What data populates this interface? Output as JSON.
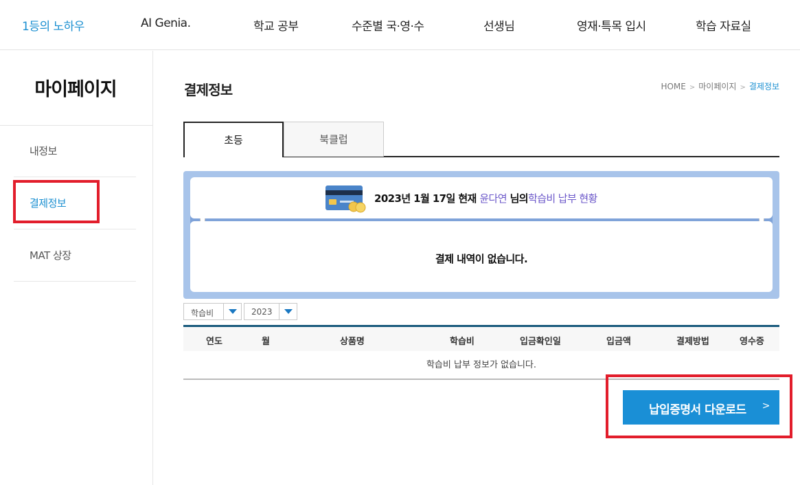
{
  "topnav": {
    "items": [
      "1등의 노하우",
      "AI Genia.",
      "학교 공부",
      "수준별 국·영·수",
      "선생님",
      "영재·특목 입시",
      "학습 자료실"
    ]
  },
  "sidebar": {
    "title": "마이페이지",
    "items": [
      "내정보",
      "결제정보",
      "MAT 상장"
    ]
  },
  "page": {
    "title": "결제정보",
    "breadcrumb": [
      "HOME",
      "마이페이지",
      "결제정보"
    ]
  },
  "tabs": [
    "초등",
    "북클럽"
  ],
  "status": {
    "date_text": "2023년 1월 17일 현재",
    "name": "윤다연",
    "suffix": "님의",
    "subject": "학습비 납부 현황",
    "empty_message": "결제 내역이 없습니다."
  },
  "filters": {
    "type": "학습비",
    "year": "2023"
  },
  "table": {
    "headers": [
      "연도",
      "월",
      "상품명",
      "학습비",
      "입금확인일",
      "입금액",
      "결제방법",
      "영수증"
    ],
    "empty_message": "학습비 납부 정보가 없습니다."
  },
  "download_button": {
    "label": "납입증명서 다운로드",
    "chevron": ">"
  },
  "colors": {
    "accent": "#1a8fd1",
    "highlight": "#6b57c9",
    "annotation_red": "#e21d2b"
  }
}
